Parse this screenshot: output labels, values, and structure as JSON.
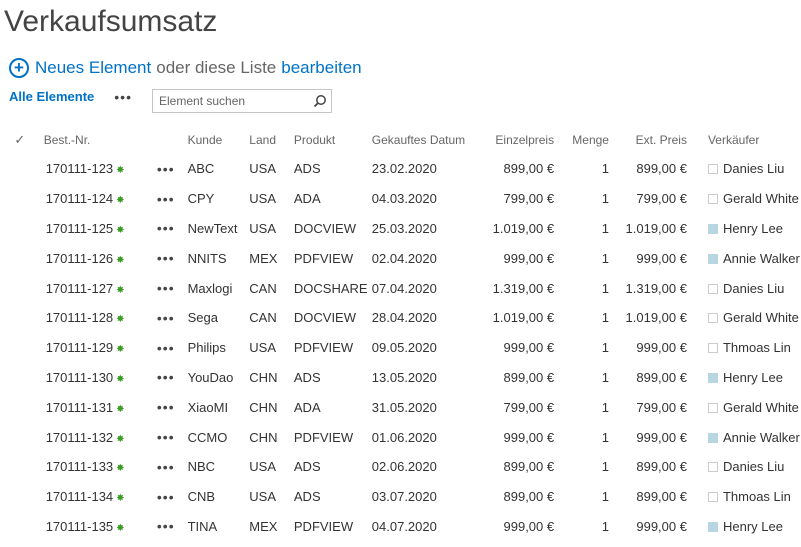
{
  "page": {
    "title": "Verkaufsumsatz",
    "new_item_label": "Neues Element",
    "or_text": "oder diese Liste",
    "edit_label": "bearbeiten",
    "view_label": "Alle Elemente",
    "more_label": "•••",
    "search_placeholder": "Element suchen"
  },
  "table": {
    "check_header": "✓",
    "headers": {
      "id": "Best.-Nr.",
      "customer": "Kunde",
      "country": "Land",
      "product": "Produkt",
      "date": "Gekauftes Datum",
      "unit_price": "Einzelpreis",
      "quantity": "Menge",
      "ext_price": "Ext. Preis",
      "seller": "Verkäufer"
    },
    "rows": [
      {
        "id": "170111-123",
        "customer": "ABC",
        "country": "USA",
        "product": "ADS",
        "date": "23.02.2020",
        "unit_price": "899,00 €",
        "quantity": "1",
        "ext_price": "899,00 €",
        "seller": "Danies Liu",
        "seller_swatch": "#ffffff"
      },
      {
        "id": "170111-124",
        "customer": "CPY",
        "country": "USA",
        "product": "ADA",
        "date": "04.03.2020",
        "unit_price": "799,00 €",
        "quantity": "1",
        "ext_price": "799,00 €",
        "seller": "Gerald White",
        "seller_swatch": "#ffffff"
      },
      {
        "id": "170111-125",
        "customer": "NewText",
        "country": "USA",
        "product": "DOCVIEW",
        "date": "25.03.2020",
        "unit_price": "1.019,00 €",
        "quantity": "1",
        "ext_price": "1.019,00 €",
        "seller": "Henry Lee",
        "seller_swatch": "#b7d6e1"
      },
      {
        "id": "170111-126",
        "customer": "NNITS",
        "country": "MEX",
        "product": "PDFVIEW",
        "date": "02.04.2020",
        "unit_price": "999,00 €",
        "quantity": "1",
        "ext_price": "999,00 €",
        "seller": "Annie Walker",
        "seller_swatch": "#b7d6e1"
      },
      {
        "id": "170111-127",
        "customer": "Maxlogi",
        "country": "CAN",
        "product": "DOCSHARE",
        "date": "07.04.2020",
        "unit_price": "1.319,00 €",
        "quantity": "1",
        "ext_price": "1.319,00 €",
        "seller": "Danies Liu",
        "seller_swatch": "#ffffff"
      },
      {
        "id": "170111-128",
        "customer": "Sega",
        "country": "CAN",
        "product": "DOCVIEW",
        "date": "28.04.2020",
        "unit_price": "1.019,00 €",
        "quantity": "1",
        "ext_price": "1.019,00 €",
        "seller": "Gerald White",
        "seller_swatch": "#ffffff"
      },
      {
        "id": "170111-129",
        "customer": "Philips",
        "country": "USA",
        "product": "PDFVIEW",
        "date": "09.05.2020",
        "unit_price": "999,00 €",
        "quantity": "1",
        "ext_price": "999,00 €",
        "seller": "Thmoas Lin",
        "seller_swatch": "#ffffff"
      },
      {
        "id": "170111-130",
        "customer": "YouDao",
        "country": "CHN",
        "product": "ADS",
        "date": "13.05.2020",
        "unit_price": "899,00 €",
        "quantity": "1",
        "ext_price": "899,00 €",
        "seller": "Henry Lee",
        "seller_swatch": "#b7d6e1"
      },
      {
        "id": "170111-131",
        "customer": "XiaoMI",
        "country": "CHN",
        "product": "ADA",
        "date": "31.05.2020",
        "unit_price": "799,00 €",
        "quantity": "1",
        "ext_price": "799,00 €",
        "seller": "Gerald White",
        "seller_swatch": "#ffffff"
      },
      {
        "id": "170111-132",
        "customer": "CCMO",
        "country": "CHN",
        "product": "PDFVIEW",
        "date": "01.06.2020",
        "unit_price": "999,00 €",
        "quantity": "1",
        "ext_price": "999,00 €",
        "seller": "Annie Walker",
        "seller_swatch": "#b7d6e1"
      },
      {
        "id": "170111-133",
        "customer": "NBC",
        "country": "USA",
        "product": "ADS",
        "date": "02.06.2020",
        "unit_price": "899,00 €",
        "quantity": "1",
        "ext_price": "899,00 €",
        "seller": "Danies Liu",
        "seller_swatch": "#ffffff"
      },
      {
        "id": "170111-134",
        "customer": "CNB",
        "country": "USA",
        "product": "ADS",
        "date": "03.07.2020",
        "unit_price": "899,00 €",
        "quantity": "1",
        "ext_price": "899,00 €",
        "seller": "Thmoas Lin",
        "seller_swatch": "#ffffff"
      },
      {
        "id": "170111-135",
        "customer": "TINA",
        "country": "MEX",
        "product": "PDFVIEW",
        "date": "04.07.2020",
        "unit_price": "999,00 €",
        "quantity": "1",
        "ext_price": "999,00 €",
        "seller": "Henry Lee",
        "seller_swatch": "#b7d6e1"
      }
    ]
  },
  "colors": {
    "accent": "#0072c6",
    "new_item_icon": "#3a9d23"
  },
  "icons": {
    "add": "plus-circle-icon",
    "search": "search-icon",
    "new_item": "new-item-sparkle-icon",
    "more": "ellipsis-icon",
    "check": "checkmark-icon"
  }
}
